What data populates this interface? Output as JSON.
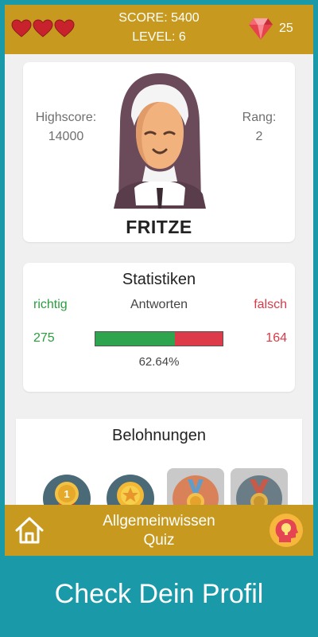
{
  "header": {
    "lives": 3,
    "score_text": "SCORE: 5400",
    "level_text": "LEVEL: 6",
    "gems": "25"
  },
  "profile": {
    "highscore_label": "Highscore:",
    "highscore_value": "14000",
    "rank_label": "Rang:",
    "rank_value": "2",
    "name": "FRITZE",
    "avatar_icon": "nun-avatar-icon"
  },
  "stats": {
    "title": "Statistiken",
    "correct_label": "richtig",
    "answers_label": "Antworten",
    "wrong_label": "falsch",
    "correct_count": "275",
    "wrong_count": "164",
    "correct_ratio": 0.6264,
    "percent_text": "62.64%"
  },
  "rewards": {
    "title": "Belohnungen",
    "medals": [
      {
        "icon": "gold-medal-1-icon",
        "locked": false
      },
      {
        "icon": "star-medal-icon",
        "locked": false
      },
      {
        "icon": "ribbon-medal-icon",
        "locked": true
      },
      {
        "icon": "bronze-medal-icon",
        "locked": true
      }
    ]
  },
  "footer": {
    "title_line1": "Allgemeinwissen",
    "title_line2": "Quiz",
    "home_icon": "home-icon",
    "hint_icon": "lightbulb-head-icon"
  },
  "caption": "Check Dein Profil",
  "colors": {
    "bar_gold": "#c79a1f",
    "background_teal": "#1a9aa8",
    "correct_green": "#2a9d3f",
    "wrong_red": "#d93a48"
  }
}
